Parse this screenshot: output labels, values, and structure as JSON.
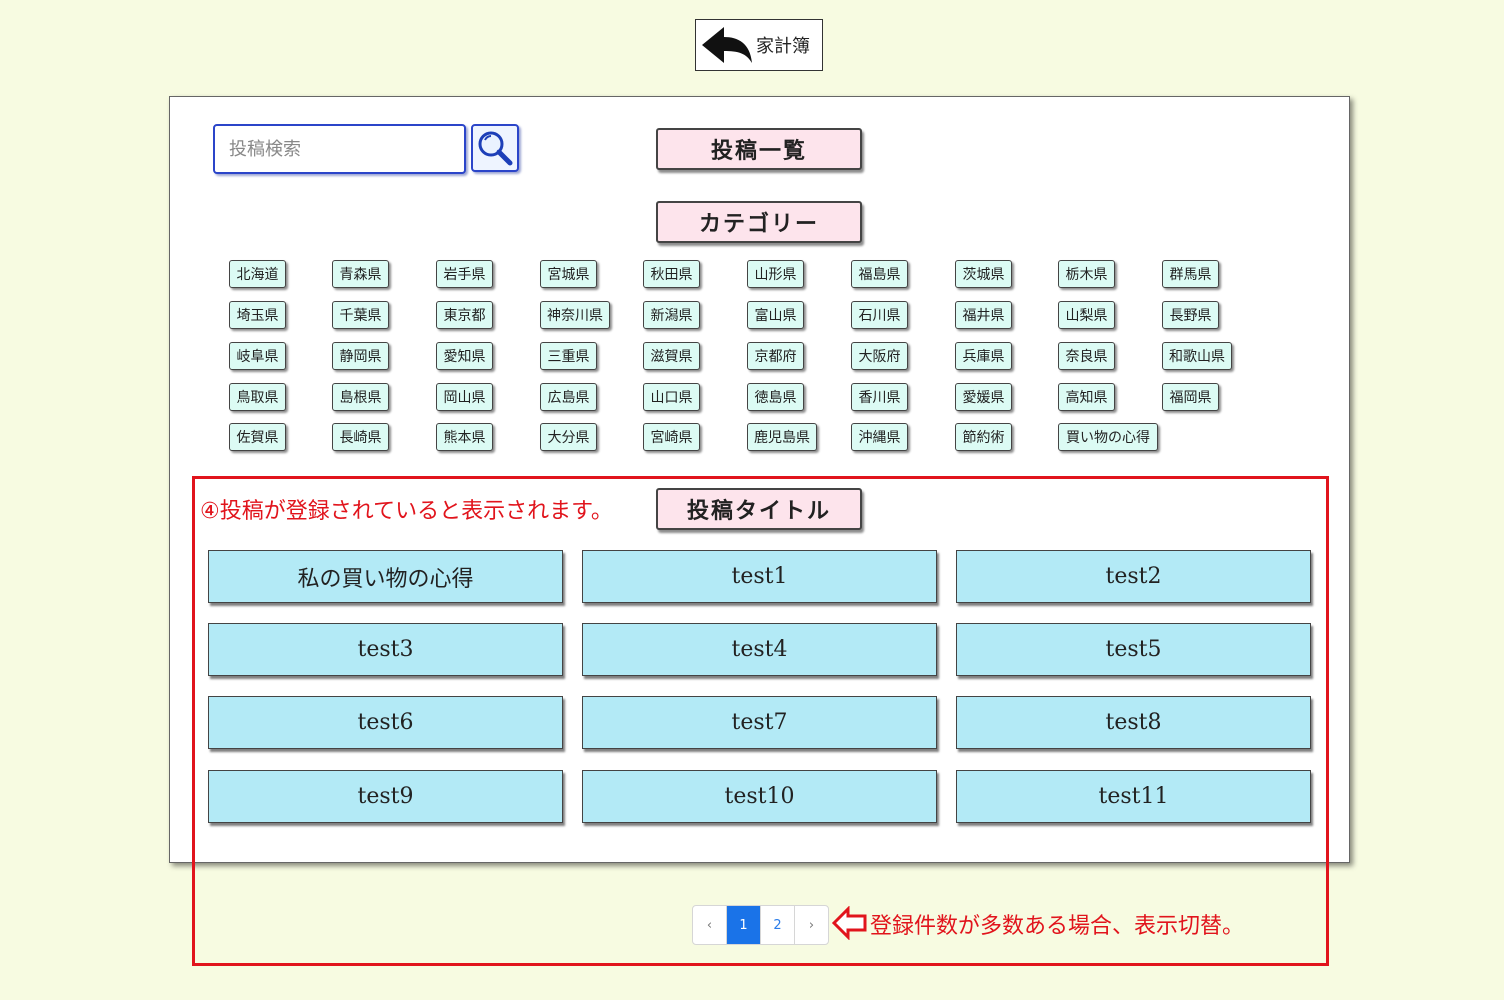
{
  "back_button": {
    "label": "家計簿"
  },
  "search": {
    "placeholder": "投稿検索"
  },
  "headings": {
    "post_list": "投稿一覧",
    "category": "カテゴリー",
    "post_title": "投稿タイトル"
  },
  "categories": [
    "北海道",
    "青森県",
    "岩手県",
    "宮城県",
    "秋田県",
    "山形県",
    "福島県",
    "茨城県",
    "栃木県",
    "群馬県",
    "埼玉県",
    "千葉県",
    "東京都",
    "神奈川県",
    "新潟県",
    "富山県",
    "石川県",
    "福井県",
    "山梨県",
    "長野県",
    "岐阜県",
    "静岡県",
    "愛知県",
    "三重県",
    "滋賀県",
    "京都府",
    "大阪府",
    "兵庫県",
    "奈良県",
    "和歌山県",
    "鳥取県",
    "島根県",
    "岡山県",
    "広島県",
    "山口県",
    "徳島県",
    "香川県",
    "愛媛県",
    "高知県",
    "福岡県",
    "佐賀県",
    "長崎県",
    "熊本県",
    "大分県",
    "宮崎県",
    "鹿児島県",
    "沖縄県",
    "節約術",
    "買い物の心得"
  ],
  "posts": [
    "私の買い物の心得",
    "test1",
    "test2",
    "test3",
    "test4",
    "test5",
    "test6",
    "test7",
    "test8",
    "test9",
    "test10",
    "test11"
  ],
  "annotations": {
    "posts_note": "④投稿が登録されていると表示されます。",
    "pager_note": "登録件数が多数ある場合、表示切替。"
  },
  "pagination": {
    "prev": "‹",
    "pages": [
      "1",
      "2"
    ],
    "current": "1",
    "next": "›"
  },
  "colors": {
    "background": "#f7fbe1",
    "category_bg": "#dcfbf4",
    "post_bg": "#b3eaf6",
    "heading_bg": "#fde4ec",
    "annotation": "#e1141c",
    "page_active": "#1a73e8"
  }
}
